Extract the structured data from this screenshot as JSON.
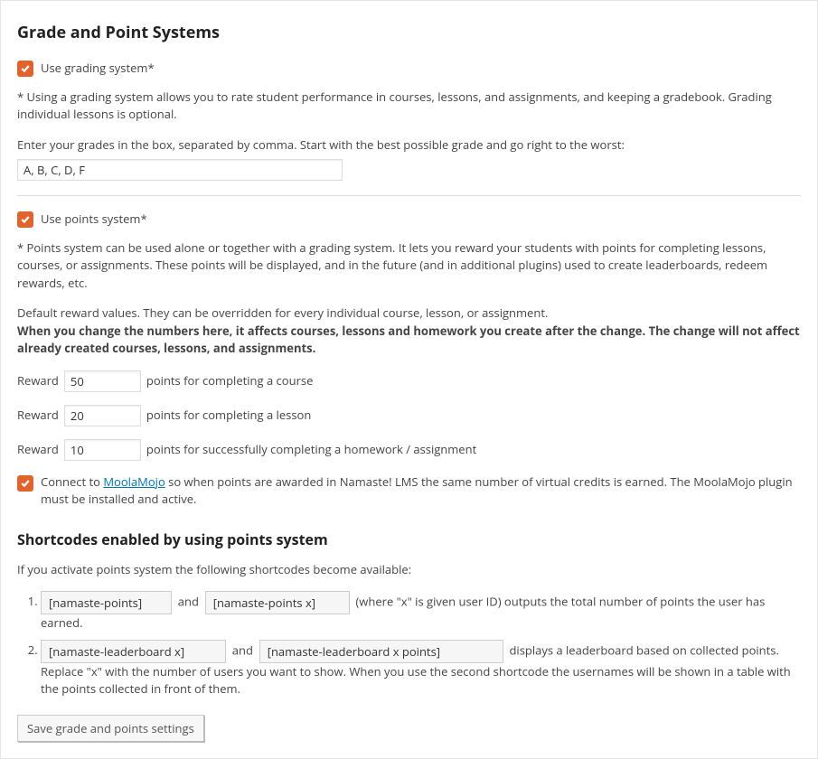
{
  "heading1": "Grade and Point Systems",
  "use_grading_label": "Use grading system*",
  "grading_help": "* Using a grading system allows you to rate student performance in courses, lessons, and assignments, and keeping a gradebook. Grading individual lessons is optional.",
  "grades_instruction": "Enter your grades in the box, separated by comma. Start with the best possible grade and go right to the worst:",
  "grades_value": "A, B, C, D, F",
  "use_points_label": "Use points system*",
  "points_help": "* Points system can be used alone or together with a grading system. It lets you reward your students with points for completing lessons, courses, or assignments. These points will be displayed, and in the future (and in additional plugins) used to create leaderboards, redeem rewards, etc.",
  "default_reward_text": "Default reward values. They can be overridden for every individual course, lesson, or assignment.",
  "change_warning": "When you change the numbers here, it affects courses, lessons and homework you create after the change. The change will not affect already created courses, lessons, and assignments.",
  "label_reward": "Reward",
  "reward_course_value": "50",
  "reward_course_suffix": "points for completing a course",
  "reward_lesson_value": "20",
  "reward_lesson_suffix": "points for completing a lesson",
  "reward_assignment_value": "10",
  "reward_assignment_suffix": "points for successfully completing a homework / assignment",
  "connect_prefix": "Connect to ",
  "moolamojo_label": "MoolaMojo",
  "connect_suffix": " so when points are awarded in Namaste! LMS the same number of virtual credits is earned. The MoolaMojo plugin must be installed and active.",
  "heading_shortcodes": "Shortcodes enabled by using points system",
  "shortcodes_intro": "If you activate points system the following shortcodes become available:",
  "sc1a": "[namaste-points]",
  "and": "and",
  "sc1b": "[namaste-points x]",
  "sc1_suffix": "(where \"x\" is given user ID) outputs the total number of points the user has earned.",
  "sc2a": "[namaste-leaderboard x]",
  "sc2b": "[namaste-leaderboard x points]",
  "sc2_suffix1": "displays a leaderboard based on collected points. Replace \"x\"",
  "sc2_suffix2": "with the number of users you want to show. When you use the second shortcode the usernames will be shown in a table with the points collected in front of them.",
  "save_button": "Save grade and points settings"
}
